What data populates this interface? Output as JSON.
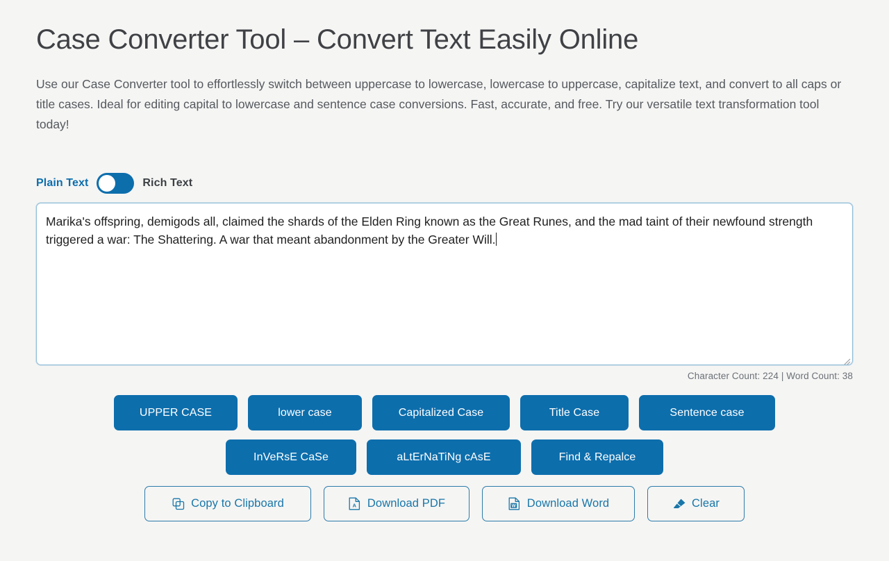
{
  "header": {
    "title": "Case Converter Tool – Convert Text Easily Online",
    "description": "Use our Case Converter tool to effortlessly switch between uppercase to lowercase, lowercase to uppercase, capitalize text, and convert to all caps or title cases. Ideal for editing capital to lowercase and sentence case conversions. Fast, accurate, and free. Try our versatile text transformation tool today!"
  },
  "mode_toggle": {
    "left_label": "Plain Text",
    "right_label": "Rich Text",
    "active": "Plain Text",
    "knob_position": "left",
    "accent_color": "#0d6eac"
  },
  "editor": {
    "value": "Marika's offspring, demigods all, claimed the shards of the Elden Ring known as the Great Runes, and the mad taint of their newfound strength triggered a war: The Shattering. A war that meant abandonment by the Greater Will.",
    "placeholder": "",
    "focused": true,
    "border_color": "#8ebdd8"
  },
  "counter": {
    "text": "Character Count: 224 | Word Count: 38",
    "character_count": 224,
    "word_count": 38
  },
  "case_buttons_row1": [
    {
      "label": "UPPER CASE",
      "name": "upper-case-button"
    },
    {
      "label": "lower case",
      "name": "lower-case-button"
    },
    {
      "label": "Capitalized Case",
      "name": "capitalized-case-button"
    },
    {
      "label": "Title Case",
      "name": "title-case-button"
    },
    {
      "label": "Sentence case",
      "name": "sentence-case-button"
    }
  ],
  "case_buttons_row2": [
    {
      "label": "InVeRsE CaSe",
      "name": "inverse-case-button"
    },
    {
      "label": "aLtErNaTiNg cAsE",
      "name": "alternating-case-button"
    },
    {
      "label": "Find & Repalce",
      "name": "find-replace-button"
    }
  ],
  "action_buttons": [
    {
      "label": "Copy to Clipboard",
      "icon": "copy-icon"
    },
    {
      "label": "Download PDF",
      "icon": "pdf-file-icon"
    },
    {
      "label": "Download Word",
      "icon": "word-file-icon"
    },
    {
      "label": "Clear",
      "icon": "eraser-icon"
    }
  ],
  "colors": {
    "primary": "#0d6eac",
    "outline": "#2b7ba8",
    "background": "#f5f5f4",
    "text": "#3c4043"
  }
}
